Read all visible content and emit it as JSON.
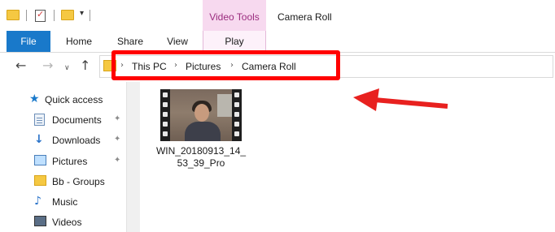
{
  "window": {
    "title": "Camera Roll",
    "context_tab_group": "Video Tools"
  },
  "ribbon": {
    "tabs": [
      {
        "label": "File",
        "active": false
      },
      {
        "label": "Home",
        "active": false
      },
      {
        "label": "Share",
        "active": false
      },
      {
        "label": "View",
        "active": false
      },
      {
        "label": "Play",
        "active": true
      }
    ]
  },
  "address": {
    "breadcrumb": [
      "This PC",
      "Pictures",
      "Camera Roll"
    ]
  },
  "nav_pane": {
    "items": [
      {
        "label": "Quick access",
        "icon": "star-icon",
        "pinned": false
      },
      {
        "label": "Documents",
        "icon": "document-icon",
        "pinned": true
      },
      {
        "label": "Downloads",
        "icon": "download-icon",
        "pinned": true
      },
      {
        "label": "Pictures",
        "icon": "pictures-icon",
        "pinned": true
      },
      {
        "label": "Bb - Groups",
        "icon": "folder-icon",
        "pinned": false
      },
      {
        "label": "Music",
        "icon": "music-icon",
        "pinned": false
      },
      {
        "label": "Videos",
        "icon": "video-icon",
        "pinned": false
      }
    ]
  },
  "files": [
    {
      "name": "WIN_20180913_14_53_39_Pro",
      "type": "video"
    }
  ],
  "annotation": {
    "highlight_color": "#ff0000",
    "arrow_color": "#e8211f"
  },
  "colors": {
    "file_tab": "#1979ca",
    "context_tab_bg": "#f7d9ef",
    "context_tab_text": "#9b2d7f",
    "folder": "#f5c842"
  }
}
